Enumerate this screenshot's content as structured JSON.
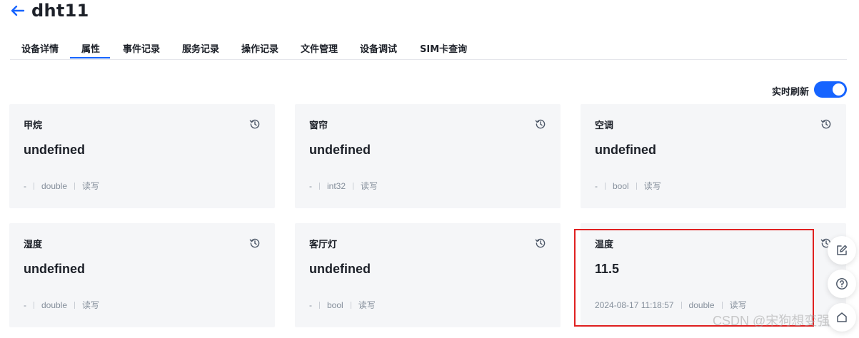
{
  "header": {
    "title": "dht11"
  },
  "tabs": [
    {
      "label": "设备详情"
    },
    {
      "label": "属性"
    },
    {
      "label": "事件记录"
    },
    {
      "label": "服务记录"
    },
    {
      "label": "操作记录"
    },
    {
      "label": "文件管理"
    },
    {
      "label": "设备调试"
    },
    {
      "label": "SIM卡查询"
    }
  ],
  "active_tab": "属性",
  "realtime_refresh": {
    "label": "实时刷新",
    "enabled": true
  },
  "properties": [
    {
      "name": "甲烷",
      "value": "undefined",
      "time": "-",
      "type": "double",
      "access": "读写"
    },
    {
      "name": "窗帘",
      "value": "undefined",
      "time": "-",
      "type": "int32",
      "access": "读写"
    },
    {
      "name": "空调",
      "value": "undefined",
      "time": "-",
      "type": "bool",
      "access": "读写"
    },
    {
      "name": "湿度",
      "value": "undefined",
      "time": "-",
      "type": "double",
      "access": "读写"
    },
    {
      "name": "客厅灯",
      "value": "undefined",
      "time": "-",
      "type": "bool",
      "access": "读写"
    },
    {
      "name": "温度",
      "value": "11.5",
      "time": "2024-08-17 11:18:57",
      "type": "double",
      "access": "读写"
    }
  ],
  "colors": {
    "accent": "#1664ff",
    "highlight_border": "#e02020",
    "card_bg": "#f5f6f8"
  },
  "watermark": "CSDN @宋狗想变强"
}
